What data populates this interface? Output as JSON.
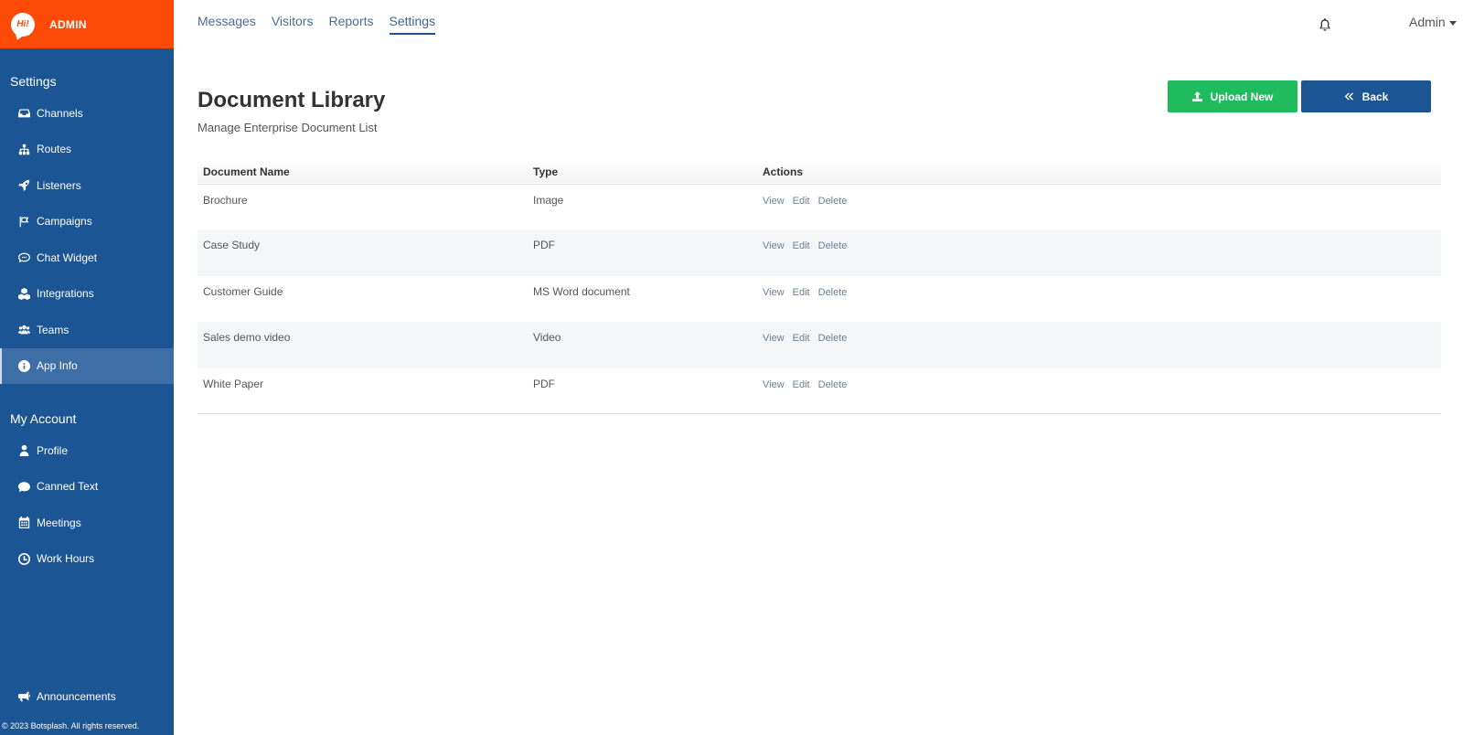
{
  "brand": {
    "logo_text": "Hi!",
    "title": "ADMIN",
    "color": "#fd4a07"
  },
  "sidebar": {
    "bg_color": "#1c5594",
    "settings_title": "Settings",
    "settings_items": [
      {
        "label": "Channels",
        "icon": "inbox-icon"
      },
      {
        "label": "Routes",
        "icon": "sitemap-icon"
      },
      {
        "label": "Listeners",
        "icon": "rocket-icon"
      },
      {
        "label": "Campaigns",
        "icon": "flag-icon"
      },
      {
        "label": "Chat Widget",
        "icon": "comment-icon"
      },
      {
        "label": "Integrations",
        "icon": "cubes-icon"
      },
      {
        "label": "Teams",
        "icon": "users-icon"
      },
      {
        "label": "App Info",
        "icon": "info-icon",
        "active": true
      }
    ],
    "account_title": "My Account",
    "account_items": [
      {
        "label": "Profile",
        "icon": "user-icon"
      },
      {
        "label": "Canned Text",
        "icon": "speech-bubble-icon"
      },
      {
        "label": "Meetings",
        "icon": "calendar-icon"
      },
      {
        "label": "Work Hours",
        "icon": "clock-icon"
      }
    ],
    "announcements": "Announcements",
    "footer": "© 2023 Botsplash. All rights reserved."
  },
  "topnav": {
    "tabs": [
      "Messages",
      "Visitors",
      "Reports",
      "Settings"
    ],
    "active": "Settings",
    "user": "Admin"
  },
  "page": {
    "title": "Document Library",
    "subtitle": "Manage Enterprise Document List",
    "upload_label": "Upload New",
    "back_label": "Back",
    "upload_color": "#1ebc5c",
    "back_color": "#1c5594"
  },
  "table": {
    "headers": [
      "Document Name",
      "Type",
      "Actions"
    ],
    "actions": [
      "View",
      "Edit",
      "Delete"
    ],
    "rows": [
      {
        "name": "Brochure",
        "type": "Image"
      },
      {
        "name": "Case Study",
        "type": "PDF"
      },
      {
        "name": "Customer Guide",
        "type": "MS Word document"
      },
      {
        "name": "Sales demo video",
        "type": "Video"
      },
      {
        "name": "White Paper",
        "type": "PDF"
      }
    ]
  }
}
